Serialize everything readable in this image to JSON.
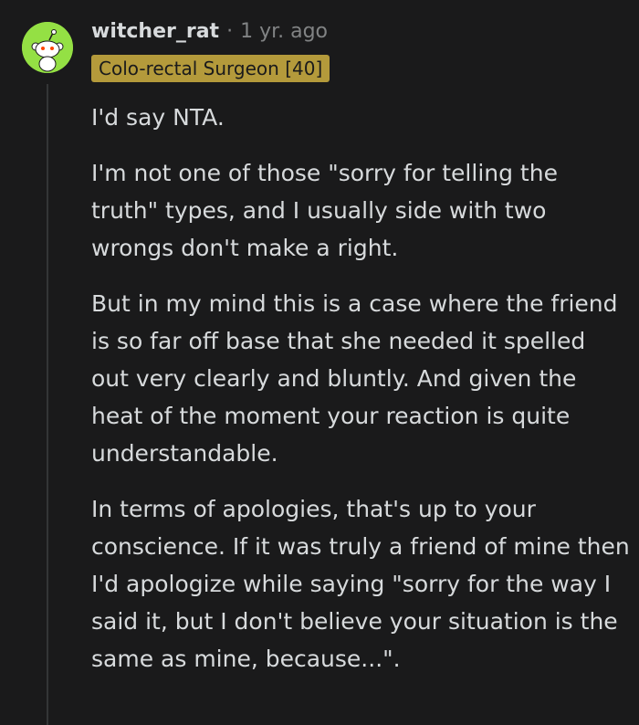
{
  "comment": {
    "avatar_icon": "snoo-avatar-icon",
    "username": "witcher_rat",
    "separator": "·",
    "age": "1 yr. ago",
    "flair": "Colo-rectal Surgeon [40]",
    "flair_color": "#b49a3b",
    "avatar_color": "#94e044",
    "paragraphs": [
      "I'd say NTA.",
      "I'm not one of those \"sorry for telling the truth\" types, and I usually side with two wrongs don't make a right.",
      "But in my mind this is a case where the friend is so far off base that she needed it spelled out very clearly and bluntly. And given the heat of the moment your reaction is quite understandable.",
      "In terms of apologies, that's up to your conscience. If it was truly a friend of mine then I'd apologize while saying \"sorry for the way I said it, but I don't believe your situation is the same as mine, because...\"."
    ]
  }
}
